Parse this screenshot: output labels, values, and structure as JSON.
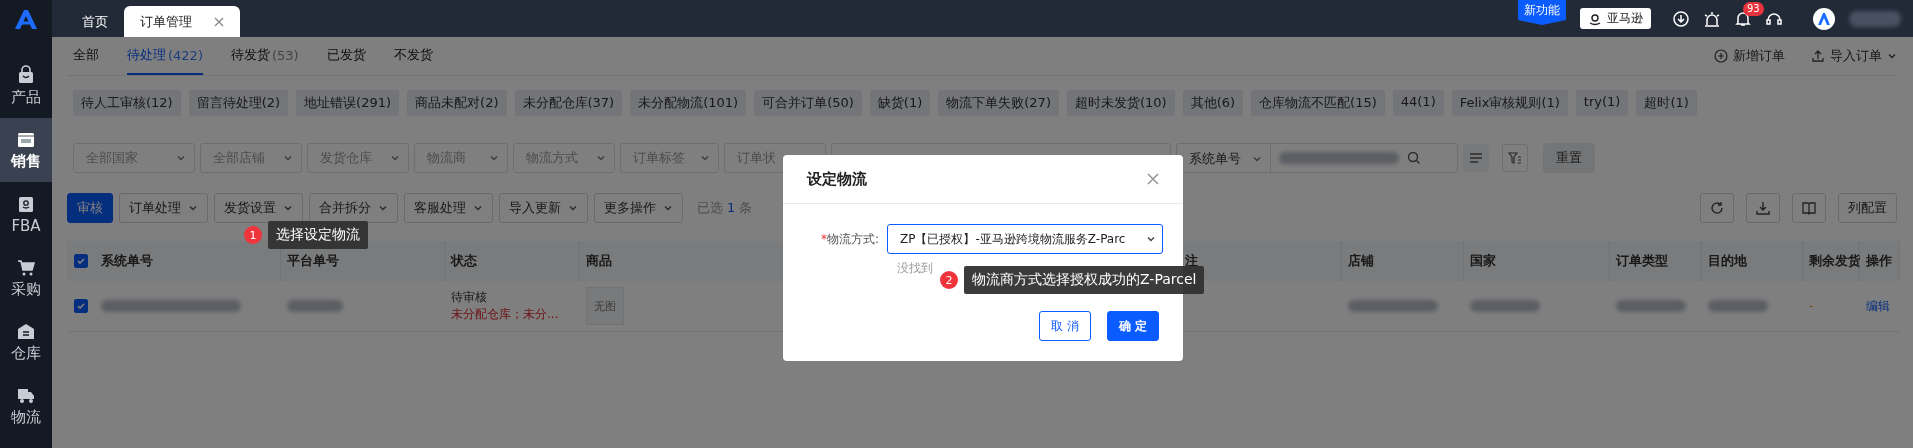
{
  "top_tabs": [
    {
      "label": "首页",
      "selected": false,
      "closable": false
    },
    {
      "label": "订单管理",
      "selected": true,
      "closable": true
    }
  ],
  "topbar": {
    "new_feature": "新功能",
    "store_button": "亚马逊",
    "notification_count": "93"
  },
  "sidebar": {
    "items": [
      {
        "label": "产品",
        "kind": "bag",
        "selected": false
      },
      {
        "label": "销售",
        "kind": "sel",
        "selected": true
      },
      {
        "label": "FBA",
        "kind": "fba",
        "selected": false
      },
      {
        "label": "采购",
        "kind": "cart",
        "selected": false
      },
      {
        "label": "仓库",
        "kind": "warehouse",
        "selected": false
      },
      {
        "label": "物流",
        "kind": "truck",
        "selected": false
      }
    ]
  },
  "status_tabs": [
    {
      "label": "全部",
      "selected": false
    },
    {
      "label": "待处理",
      "count": "(422)",
      "selected": true
    },
    {
      "label": "待发货",
      "count": "(53)",
      "selected": false
    },
    {
      "label": "已发货",
      "selected": false
    },
    {
      "label": "不发货",
      "selected": false
    }
  ],
  "actions": [
    {
      "label": "新增订单",
      "kind": "add"
    },
    {
      "label": "导入订单",
      "kind": "import"
    }
  ],
  "tags": [
    "待人工审核(12)",
    "留言待处理(2)",
    "地址错误(291)",
    "商品未配对(2)",
    "未分配仓库(37)",
    "未分配物流(101)",
    "可合并订单(50)",
    "缺货(1)",
    "物流下单失败(27)",
    "超时未发货(10)",
    "其他(6)",
    "仓库物流不匹配(15)",
    "44(1)",
    "Felix审核规则(1)",
    "try(1)",
    "超时(1)"
  ],
  "filters": {
    "selects": [
      "全部国家",
      "全部店铺",
      "发货仓库",
      "物流商",
      "物流方式",
      "订单标签",
      "订单状"
    ],
    "search_type": "系统单号",
    "reset": "重置"
  },
  "toolbar": {
    "primary": "审核",
    "menus": [
      "订单处理",
      "发货设置",
      "合并拆分",
      "客服处理",
      "导入更新",
      "更多操作"
    ],
    "selected_prefix": "已选",
    "selected_count": "1",
    "selected_suffix": "条",
    "column_config": "列配置"
  },
  "table": {
    "all_checked": true,
    "columns": [
      "系统单号",
      "平台单号",
      "状态",
      "商品",
      "注",
      "店铺",
      "国家",
      "订单类型",
      "目的地",
      "剩余发货",
      "操作"
    ],
    "rows": [
      {
        "checked": true,
        "status": "待审核",
        "status_note": "未分配仓库；未分...",
        "product_image": "无图",
        "remaining": "-",
        "action": "编辑"
      }
    ]
  },
  "modal": {
    "title": "设定物流",
    "required_mark": "*",
    "field_label": "物流方式:",
    "value": "ZP【已授权】-亚马逊跨境物流服务Z-Parc",
    "hint": "没找到",
    "cancel": "取 消",
    "ok": "确 定"
  },
  "guides": [
    {
      "number": "1",
      "text": "选择设定物流"
    },
    {
      "number": "2",
      "text": "物流商方式选择授权成功的Z-Parcel"
    }
  ]
}
